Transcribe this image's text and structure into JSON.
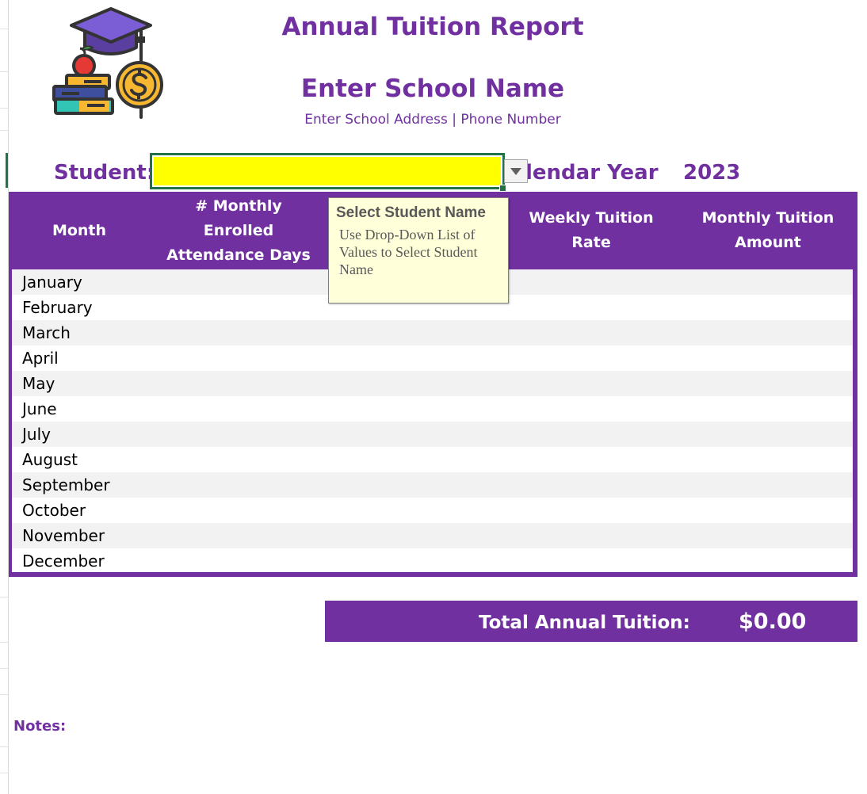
{
  "report": {
    "title": "Annual Tuition Report",
    "school_name": "Enter School Name",
    "school_address": "Enter School Address | Phone Number"
  },
  "student": {
    "label": "Student:",
    "value": "",
    "calendar_label": "lendar Year",
    "year": "2023"
  },
  "tooltip": {
    "title": "Select Student Name",
    "body": "Use Drop-Down List of Values to Select Student Name"
  },
  "table": {
    "headers": [
      "Month",
      "# Monthly Enrolled Attendance Days",
      "Weekly Tuition Rate",
      "Monthly Tuition Amount"
    ],
    "months": [
      "January",
      "February",
      "March",
      "April",
      "May",
      "June",
      "July",
      "August",
      "September",
      "October",
      "November",
      "December"
    ]
  },
  "total": {
    "label": "Total Annual Tuition:",
    "value": "$0.00"
  },
  "notes": {
    "label": "Notes:"
  },
  "colors": {
    "brand_purple": "#7030a0",
    "highlight_yellow": "#ffff00",
    "selection_green": "#217346",
    "row_shade": "#f2f2f2",
    "tooltip_bg": "#ffffd9"
  },
  "icons": [
    "graduation-cap-icon",
    "apple-icon",
    "books-icon",
    "dollar-coin-icon",
    "dropdown-arrow-icon"
  ]
}
